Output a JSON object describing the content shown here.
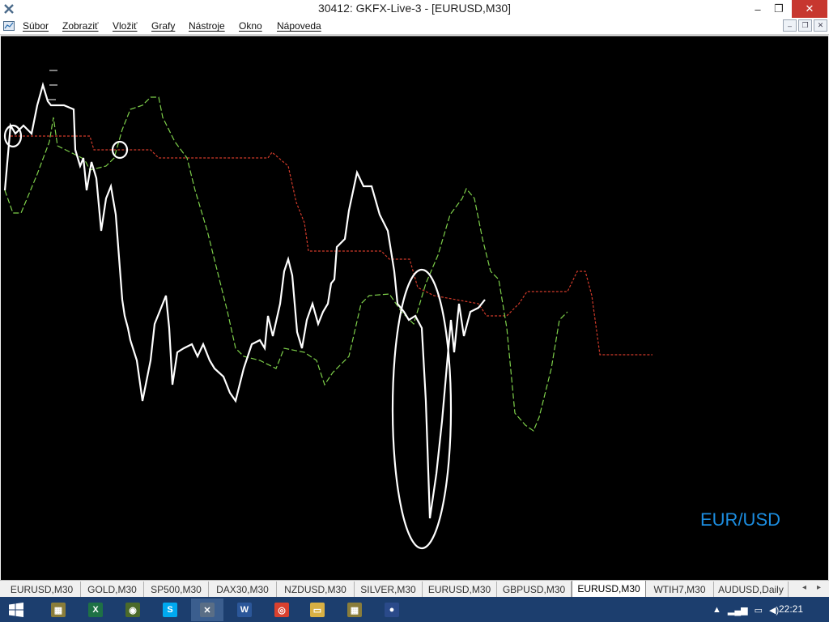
{
  "window": {
    "title": "30412: GKFX-Live-3 - [EURUSD,M30]",
    "min_glyph": "–",
    "max_glyph": "❐",
    "close_glyph": "✕"
  },
  "menu": {
    "items": [
      "Súbor",
      "Zobraziť",
      "Vložiť",
      "Grafy",
      "Nástroje",
      "Okno",
      "Nápoveda"
    ]
  },
  "mdi": {
    "min_glyph": "–",
    "restore_glyph": "❐",
    "close_glyph": "✕"
  },
  "chart": {
    "caption": "EUR/USD",
    "colors": {
      "background": "#000000",
      "price": "#ffffff",
      "green": "#7ed04a",
      "red": "#d03a2a",
      "caption": "#1c8de0"
    }
  },
  "tabs": {
    "items": [
      "EURUSD,M30",
      "GOLD,M30",
      "SP500,M30",
      "DAX30,M30",
      "NZDUSD,M30",
      "SILVER,M30",
      "EURUSD,M30",
      "GBPUSD,M30",
      "EURUSD,M30",
      "WTIH7,M30",
      "AUDUSD,Daily"
    ],
    "active_index": 8,
    "left_arrow": "◂",
    "right_arrow": "▸"
  },
  "taskbar": {
    "clock": "22:21",
    "start_icon": "windows-start-icon",
    "apps": [
      {
        "icon": "file-manager-icon",
        "color": "#8a7d3a",
        "glyph": "▦"
      },
      {
        "icon": "excel-icon",
        "color": "#1e7145",
        "glyph": "X"
      },
      {
        "icon": "globe-icon",
        "color": "#4b6a2a",
        "glyph": "◉"
      },
      {
        "icon": "skype-icon",
        "color": "#00a9f0",
        "glyph": "S"
      },
      {
        "icon": "metatrader-icon",
        "color": "#5a6e86",
        "glyph": "✕"
      },
      {
        "icon": "word-icon",
        "color": "#2b579a",
        "glyph": "W"
      },
      {
        "icon": "chrome-icon",
        "color": "#d9412f",
        "glyph": "◎"
      },
      {
        "icon": "folder-icon",
        "color": "#d8b044",
        "glyph": "▭"
      },
      {
        "icon": "photo-viewer-icon",
        "color": "#8a7d3a",
        "glyph": "▦"
      },
      {
        "icon": "pin-app-icon",
        "color": "#2a4a8a",
        "glyph": "●"
      }
    ],
    "active_app_index": 4
  }
}
